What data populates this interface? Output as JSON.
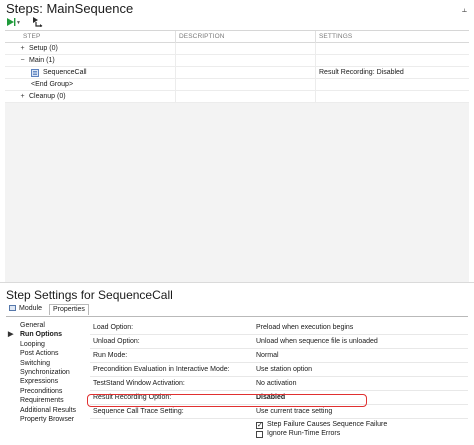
{
  "steps_pane": {
    "title": "Steps: MainSequence",
    "pin_glyph": "⫠",
    "run_dropdown_glyph": "▼",
    "columns": {
      "step": "STEP",
      "description": "DESCRIPTION",
      "settings": "SETTINGS"
    },
    "rows": [
      {
        "toggle": "+",
        "label": "Setup (0)",
        "settings": ""
      },
      {
        "toggle": "−",
        "label": "Main (1)",
        "settings": ""
      },
      {
        "toggle": "",
        "label": "SequenceCall",
        "settings": "Result Recording: Disabled"
      },
      {
        "toggle": "",
        "label": "<End Group>",
        "settings": ""
      },
      {
        "toggle": "+",
        "label": "Cleanup (0)",
        "settings": ""
      }
    ]
  },
  "props_pane": {
    "title": "Step Settings for SequenceCall",
    "tabs": {
      "module": "Module",
      "properties": "Properties"
    },
    "categories": [
      {
        "label": "General",
        "active": false
      },
      {
        "label": "Run Options",
        "active": true
      },
      {
        "label": "Looping",
        "active": false
      },
      {
        "label": "Post Actions",
        "active": false
      },
      {
        "label": "Switching",
        "active": false
      },
      {
        "label": "Synchronization",
        "active": false
      },
      {
        "label": "Expressions",
        "active": false
      },
      {
        "label": "Preconditions",
        "active": false
      },
      {
        "label": "Requirements",
        "active": false
      },
      {
        "label": "Additional Results",
        "active": false
      },
      {
        "label": "Property Browser",
        "active": false
      }
    ],
    "active_arrow": "▶",
    "properties": [
      {
        "name": "Load Option:",
        "value": "Preload when execution begins"
      },
      {
        "name": "Unload Option:",
        "value": "Unload when sequence file is unloaded"
      },
      {
        "name": "Run Mode:",
        "value": "Normal"
      },
      {
        "name": "Precondition Evaluation in Interactive Mode:",
        "value": "Use station option"
      },
      {
        "name": "TestStand Window Activation:",
        "value": "No activation"
      },
      {
        "name": "Result Recording Option:",
        "value": "Disabled"
      },
      {
        "name": "Sequence Call Trace Setting:",
        "value": "Use current trace setting"
      }
    ],
    "checkboxes": [
      {
        "label": "Step Failure Causes Sequence Failure",
        "checked": true
      },
      {
        "label": "Ignore Run-Time Errors",
        "checked": false
      }
    ]
  },
  "colors": {
    "highlight_outline": "#e03030",
    "run_green": "#1f9a3a"
  }
}
